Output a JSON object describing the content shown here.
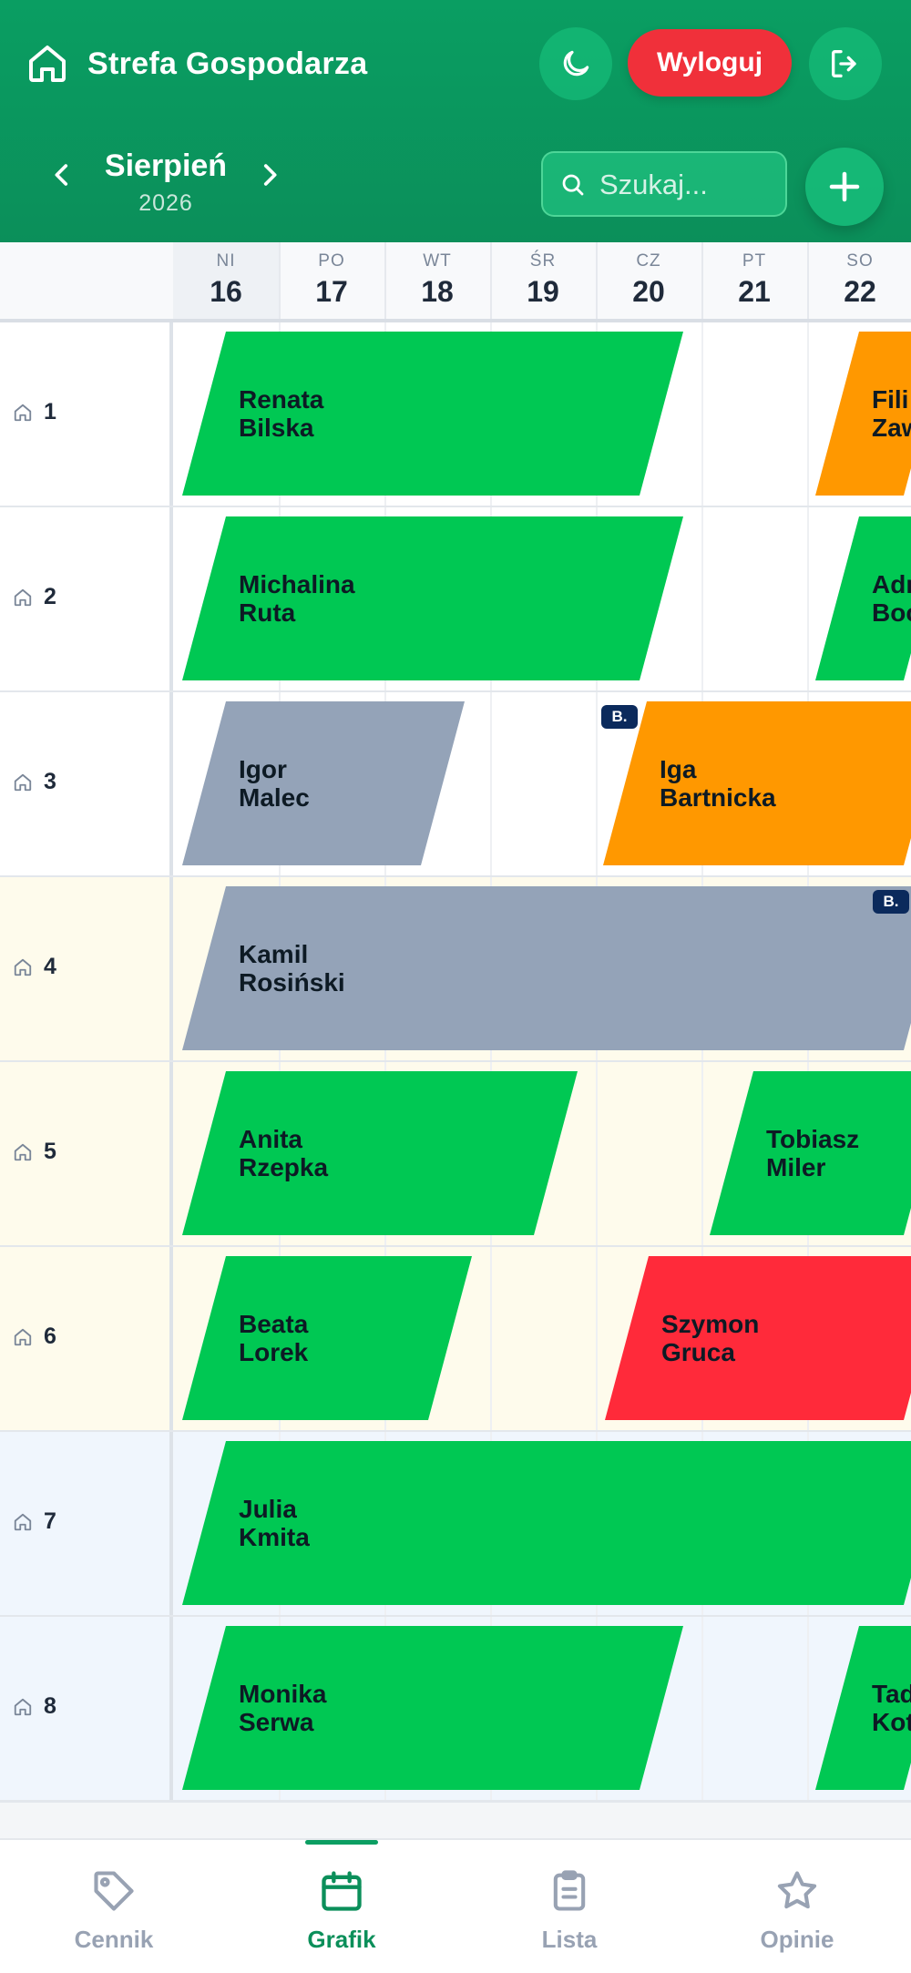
{
  "header": {
    "title": "Strefa Gospodarza",
    "logout_label": "Wyloguj",
    "month": "Sierpień",
    "year": "2026",
    "search_placeholder": "Szukaj..."
  },
  "days": [
    {
      "name": "NI",
      "num": "16"
    },
    {
      "name": "PO",
      "num": "17"
    },
    {
      "name": "WT",
      "num": "18"
    },
    {
      "name": "ŚR",
      "num": "19"
    },
    {
      "name": "CZ",
      "num": "20"
    },
    {
      "name": "PT",
      "num": "21"
    },
    {
      "name": "SO",
      "num": "22"
    }
  ],
  "rooms": [
    {
      "label": "1",
      "bookings": [
        {
          "name": "Renata\nBilska",
          "color": "#00c853"
        },
        {
          "name": "Fili\nZaw",
          "color": "#ff9800"
        }
      ]
    },
    {
      "label": "2",
      "bookings": [
        {
          "name": "Michalina\nRuta",
          "color": "#00c853"
        },
        {
          "name": "Adr\nBoc",
          "color": "#00c853"
        }
      ]
    },
    {
      "label": "3",
      "bookings": [
        {
          "name": "Igor\nMalec",
          "color": "#94a3b8",
          "badge": "B."
        },
        {
          "name": "Iga\nBartnicka",
          "color": "#ff9800"
        }
      ]
    },
    {
      "label": "4",
      "bookings": [
        {
          "name": "Kamil\nRosiński",
          "color": "#94a3b8",
          "badge": "B."
        }
      ]
    },
    {
      "label": "5",
      "bookings": [
        {
          "name": "Anita\nRzepka",
          "color": "#00c853"
        },
        {
          "name": "Tobiasz\nMiler",
          "color": "#00c853"
        }
      ]
    },
    {
      "label": "6",
      "bookings": [
        {
          "name": "Beata\nLorek",
          "color": "#00c853"
        },
        {
          "name": "Szymon\nGruca",
          "color": "#ff2a3a"
        }
      ]
    },
    {
      "label": "7",
      "bookings": [
        {
          "name": "Julia\nKmita",
          "color": "#00c853"
        }
      ]
    },
    {
      "label": "8",
      "bookings": [
        {
          "name": "Monika\nSerwa",
          "color": "#00c853"
        },
        {
          "name": "Tad\nKot",
          "color": "#00c853"
        }
      ]
    }
  ],
  "row_tints": [
    "#ffffff",
    "#ffffff",
    "#ffffff",
    "#fefbec",
    "#fefbec",
    "#fefbec",
    "#f0f6fd",
    "#f0f6fd"
  ],
  "bottom_nav": [
    {
      "label": "Cennik",
      "icon": "tag-icon"
    },
    {
      "label": "Grafik",
      "icon": "calendar-icon",
      "active": true
    },
    {
      "label": "Lista",
      "icon": "clipboard-icon"
    },
    {
      "label": "Opinie",
      "icon": "star-icon"
    }
  ]
}
